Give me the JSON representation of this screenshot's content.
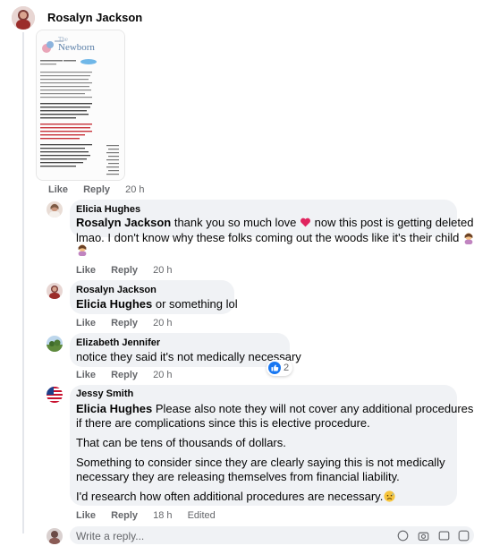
{
  "comments": [
    {
      "author": "Rosalyn Jackson",
      "actions": {
        "like": "Like",
        "reply": "Reply",
        "time": "20 h"
      },
      "attachment": {
        "logo_line1": "The",
        "logo_line2": "Newborn"
      }
    },
    {
      "author": "Elicia Hughes",
      "mention": "Rosalyn Jackson",
      "text_before_emoji": " thank you so much love ",
      "text_after_emoji": " now this post is getting deleted",
      "text_line2": "lmao. I don't know why these folks coming out the woods like it's their child ",
      "actions": {
        "like": "Like",
        "reply": "Reply",
        "time": "20 h"
      }
    },
    {
      "author": "Rosalyn Jackson",
      "mention": "Elicia Hughes",
      "text": " or something lol",
      "actions": {
        "like": "Like",
        "reply": "Reply",
        "time": "20 h"
      }
    },
    {
      "author": "Elizabeth Jennifer",
      "text": "notice they said it's not medically necessary",
      "reaction_count": "2",
      "actions": {
        "like": "Like",
        "reply": "Reply",
        "time": "20 h"
      }
    },
    {
      "author": "Jessy Smith",
      "mention": "Elicia Hughes",
      "p1_line1": " Please also note they will not cover any additional procedures",
      "p1_line2": "if there are complications since this is elective procedure.",
      "p2": "That can be tens of thousands of dollars.",
      "p3_line1": "Something to consider since they are clearly saying this is not medically",
      "p3_line2": "necessary they are releasing themselves from financial liability.",
      "p4": "I'd research how often additional procedures are necessary.",
      "actions": {
        "like": "Like",
        "reply": "Reply",
        "time": "18 h",
        "edited": "Edited"
      }
    }
  ],
  "reply_box": {
    "placeholder": "Write a reply..."
  },
  "colors": {
    "bubble": "#f0f2f5",
    "meta_text": "#65676b",
    "like_blue": "#1877f2",
    "heart_red": "#e0245e"
  }
}
